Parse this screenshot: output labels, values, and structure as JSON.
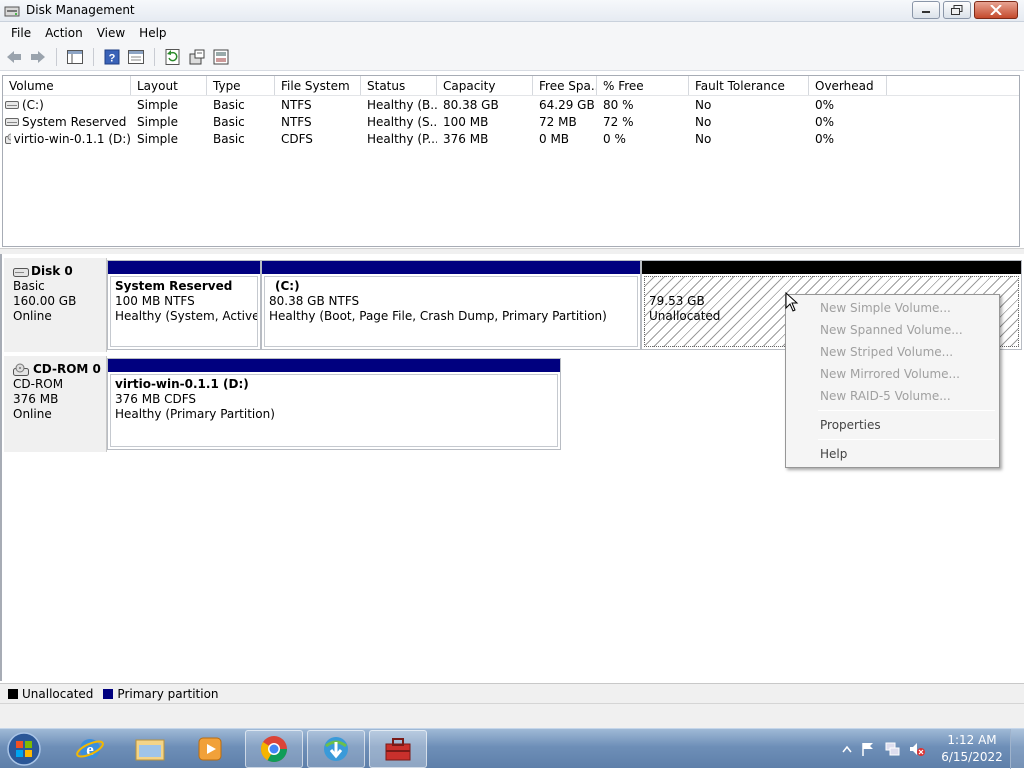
{
  "window": {
    "title": "Disk Management"
  },
  "menu": [
    "File",
    "Action",
    "View",
    "Help"
  ],
  "toolbar_icons": [
    "back-icon",
    "forward-icon",
    "console-tree-icon",
    "help-icon",
    "properties-icon",
    "refresh-icon",
    "rescan-disks-icon",
    "show-hide-icon"
  ],
  "volume_list": {
    "columns": [
      "Volume",
      "Layout",
      "Type",
      "File System",
      "Status",
      "Capacity",
      "Free Spa...",
      "% Free",
      "Fault Tolerance",
      "Overhead"
    ],
    "rows": [
      [
        "(C:)",
        "Simple",
        "Basic",
        "NTFS",
        "Healthy (B...",
        "80.38 GB",
        "64.29 GB",
        "80 %",
        "No",
        "0%"
      ],
      [
        "System Reserved",
        "Simple",
        "Basic",
        "NTFS",
        "Healthy (S...",
        "100 MB",
        "72 MB",
        "72 %",
        "No",
        "0%"
      ],
      [
        "virtio-win-0.1.1 (D:)",
        "Simple",
        "Basic",
        "CDFS",
        "Healthy (P...",
        "376 MB",
        "0 MB",
        "0 %",
        "No",
        "0%"
      ]
    ]
  },
  "disks": [
    {
      "name": "Disk 0",
      "type": "Basic",
      "size": "160.00 GB",
      "status": "Online",
      "partitions": [
        {
          "name": "System Reserved",
          "info": "100 MB NTFS",
          "status": "Healthy (System, Active, P"
        },
        {
          "name": "(C:)",
          "info": "80.38 GB NTFS",
          "status": "Healthy (Boot, Page File, Crash Dump, Primary Partition)"
        },
        {
          "size": "79.53 GB",
          "status": "Unallocated"
        }
      ]
    },
    {
      "name": "CD-ROM 0",
      "type": "CD-ROM",
      "size": "376 MB",
      "status": "Online",
      "partitions": [
        {
          "name": "virtio-win-0.1.1  (D:)",
          "info": "376 MB CDFS",
          "status": "Healthy (Primary Partition)"
        }
      ]
    }
  ],
  "legend": {
    "unallocated": "Unallocated",
    "primary": "Primary partition"
  },
  "colors": {
    "primary": "#00007f",
    "unallocated": "#000000"
  },
  "context_menu": {
    "items": [
      {
        "label": "New Simple Volume...",
        "enabled": false
      },
      {
        "label": "New Spanned Volume...",
        "enabled": false
      },
      {
        "label": "New Striped Volume...",
        "enabled": false
      },
      {
        "label": "New Mirrored Volume...",
        "enabled": false
      },
      {
        "label": "New RAID-5 Volume...",
        "enabled": false
      },
      {
        "label": "Properties",
        "enabled": true
      },
      {
        "label": "Help",
        "enabled": true
      }
    ]
  },
  "taskbar": {
    "apps": [
      "internet-explorer-icon",
      "file-explorer-icon",
      "media-player-icon",
      "chrome-icon",
      "internet-download-manager-icon",
      "toolbox-app-icon"
    ],
    "clock": {
      "time": "1:12 AM",
      "date": "6/15/2022"
    }
  }
}
